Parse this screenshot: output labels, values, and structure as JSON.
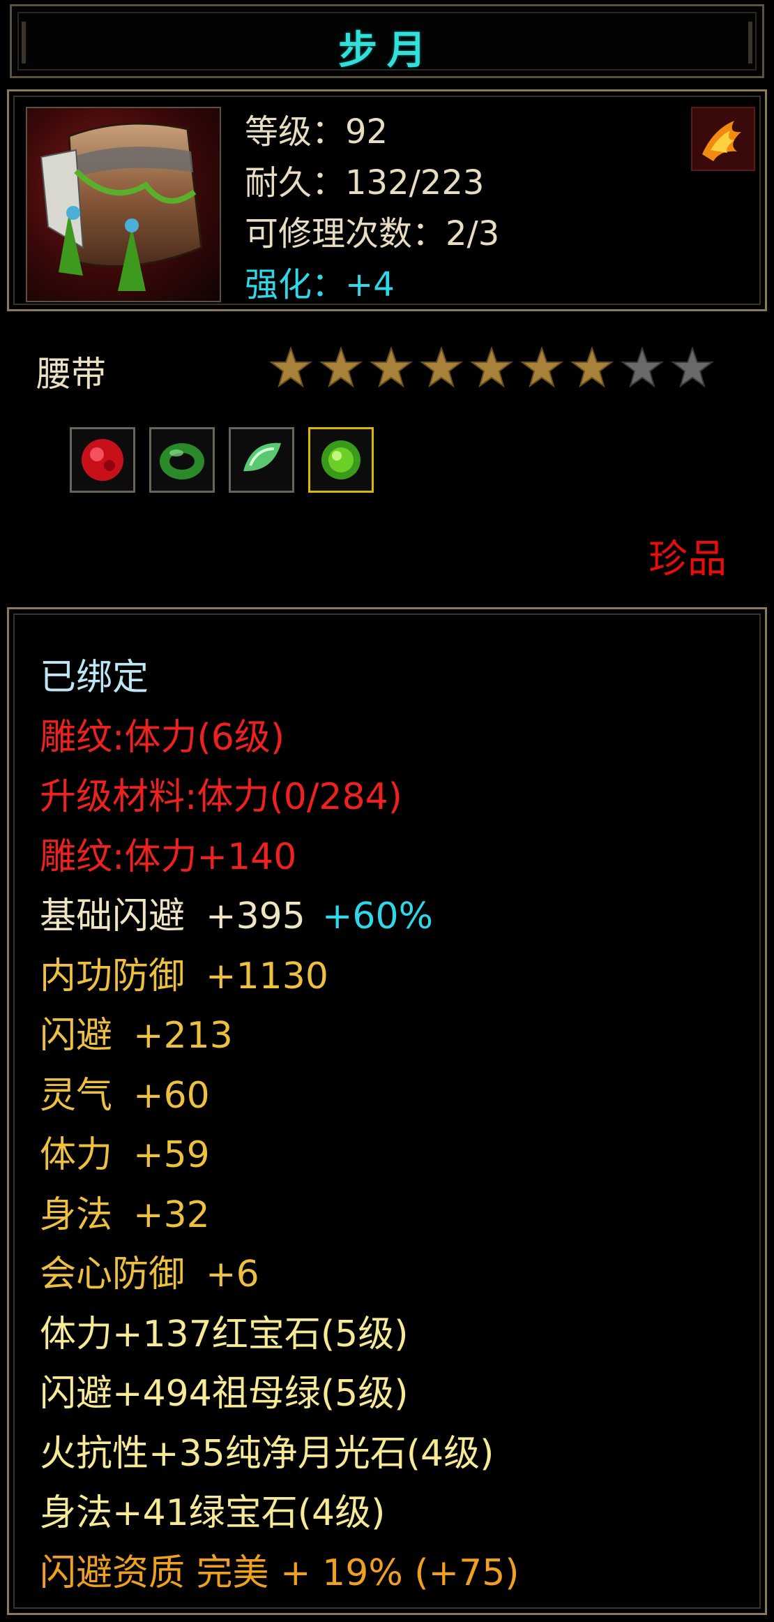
{
  "title": "步月",
  "info": {
    "level": "等级：92",
    "durability": "耐久：132/223",
    "repair": "可修理次数：2/3",
    "enhance": "强化：+4"
  },
  "item_type": "腰带",
  "stars": {
    "filled": 7,
    "total": 9
  },
  "gems": [
    "ruby-gem-icon",
    "emerald-ring-gem-icon",
    "green-crystal-gem-icon",
    "green-gem-icon"
  ],
  "quality": "珍品",
  "attributes": {
    "bound": "已绑定",
    "carving_level": "雕纹:体力(6级)",
    "upgrade_material": "升级材料:体力(0/284)",
    "carving_bonus": "雕纹:体力+140",
    "base_dodge": {
      "name": "基础闪避",
      "value": "+395",
      "percent": "+60%"
    },
    "inner_defense": {
      "name": "内功防御",
      "value": "+1130"
    },
    "dodge": {
      "name": "闪避",
      "value": "+213"
    },
    "spirit": {
      "name": "灵气",
      "value": "+60"
    },
    "stamina": {
      "name": "体力",
      "value": "+59"
    },
    "agility": {
      "name": "身法",
      "value": "+32"
    },
    "crit_defense": {
      "name": "会心防御",
      "value": "+6"
    },
    "gem1": "体力+137红宝石(5级)",
    "gem2": "闪避+494祖母绿(5级)",
    "gem3": "火抗性+35纯净月光石(4级)",
    "gem4": "身法+41绿宝石(4级)",
    "aptitude": "闪避资质 完美 + 19% (+75)"
  }
}
